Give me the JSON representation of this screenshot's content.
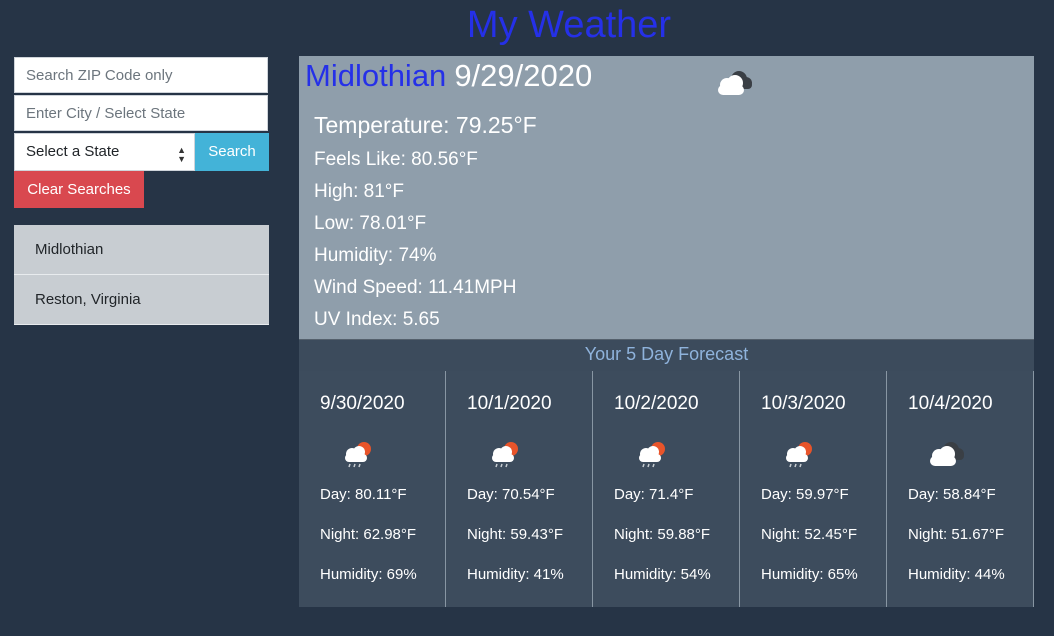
{
  "app": {
    "title": "My Weather"
  },
  "search": {
    "zip_placeholder": "Search ZIP Code only",
    "city_placeholder": "Enter City / Select State",
    "state_selected": "Select a State",
    "search_label": "Search",
    "clear_label": "Clear Searches"
  },
  "history": [
    {
      "label": "Midlothian"
    },
    {
      "label": "Reston, Virginia"
    }
  ],
  "current": {
    "city": "Midlothian",
    "date": "9/29/2020",
    "icon": "cloudy-icon",
    "temperature": "Temperature: 79.25°F",
    "feels_like": "Feels Like: 80.56°F",
    "high": "High: 81°F",
    "low": "Low: 78.01°F",
    "humidity": "Humidity: 74%",
    "wind": "Wind Speed: 11.41MPH",
    "uv": "UV Index: 5.65"
  },
  "forecast": {
    "heading": "Your 5 Day Forecast",
    "days": [
      {
        "date": "9/30/2020",
        "icon": "rain-sun-icon",
        "day": "Day: 80.11°F",
        "night": "Night: 62.98°F",
        "humidity": "Humidity: 69%"
      },
      {
        "date": "10/1/2020",
        "icon": "rain-sun-icon",
        "day": "Day: 70.54°F",
        "night": "Night: 59.43°F",
        "humidity": "Humidity: 41%"
      },
      {
        "date": "10/2/2020",
        "icon": "rain-sun-icon",
        "day": "Day: 71.4°F",
        "night": "Night: 59.88°F",
        "humidity": "Humidity: 54%"
      },
      {
        "date": "10/3/2020",
        "icon": "rain-sun-icon",
        "day": "Day: 59.97°F",
        "night": "Night: 52.45°F",
        "humidity": "Humidity: 65%"
      },
      {
        "date": "10/4/2020",
        "icon": "cloudy-icon",
        "day": "Day: 58.84°F",
        "night": "Night: 51.67°F",
        "humidity": "Humidity: 44%"
      }
    ]
  },
  "colors": {
    "background": "#263446",
    "title": "#2530e8",
    "current_panel": "#8f9eab",
    "forecast_card": "#3d4c5d",
    "search_button": "#43b3d8",
    "clear_button": "#d9484f",
    "history_item": "#c8cdd2"
  }
}
